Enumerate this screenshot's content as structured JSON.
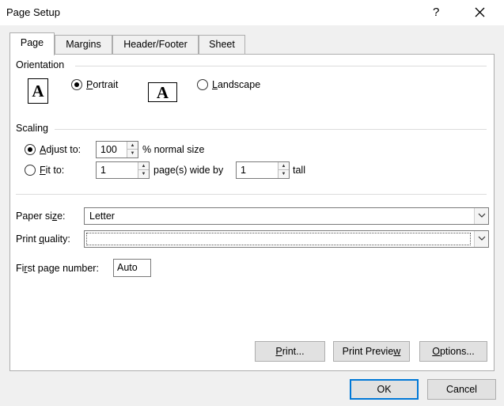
{
  "window": {
    "title": "Page Setup",
    "help_label": "?",
    "close_icon": "close-icon"
  },
  "tabs": [
    {
      "label": "Page",
      "active": true
    },
    {
      "label": "Margins",
      "active": false
    },
    {
      "label": "Header/Footer",
      "active": false
    },
    {
      "label": "Sheet",
      "active": false
    }
  ],
  "orientation": {
    "heading": "Orientation",
    "icon_letter": "A",
    "portrait": {
      "label_first": "P",
      "label_rest": "ortrait",
      "selected": true
    },
    "landscape": {
      "label_first": "L",
      "label_rest": "andscape",
      "selected": false
    }
  },
  "scaling": {
    "heading": "Scaling",
    "adjust": {
      "label_first": "A",
      "label_rest": "djust to:",
      "value": "100",
      "suffix": "% normal size",
      "selected": true
    },
    "fit": {
      "label_first": "F",
      "label_rest": "it to:",
      "wide_value": "1",
      "wide_suffix": "page(s) wide by",
      "tall_value": "1",
      "tall_suffix": "tall",
      "selected": false
    }
  },
  "paper": {
    "paper_size_label_a": "Paper si",
    "paper_size_label_u": "z",
    "paper_size_label_b": "e:",
    "paper_size_value": "Letter",
    "print_quality_label_a": "Print ",
    "print_quality_label_u": "q",
    "print_quality_label_b": "uality:",
    "print_quality_value": "",
    "first_page_label_a": "Fi",
    "first_page_label_u": "r",
    "first_page_label_b": "st page number:",
    "first_page_value": "Auto"
  },
  "buttons": {
    "print_u": "P",
    "print_rest": "rint...",
    "preview_a": "Print Previe",
    "preview_u": "w",
    "options_u": "O",
    "options_rest": "ptions...",
    "ok": "OK",
    "cancel": "Cancel"
  }
}
